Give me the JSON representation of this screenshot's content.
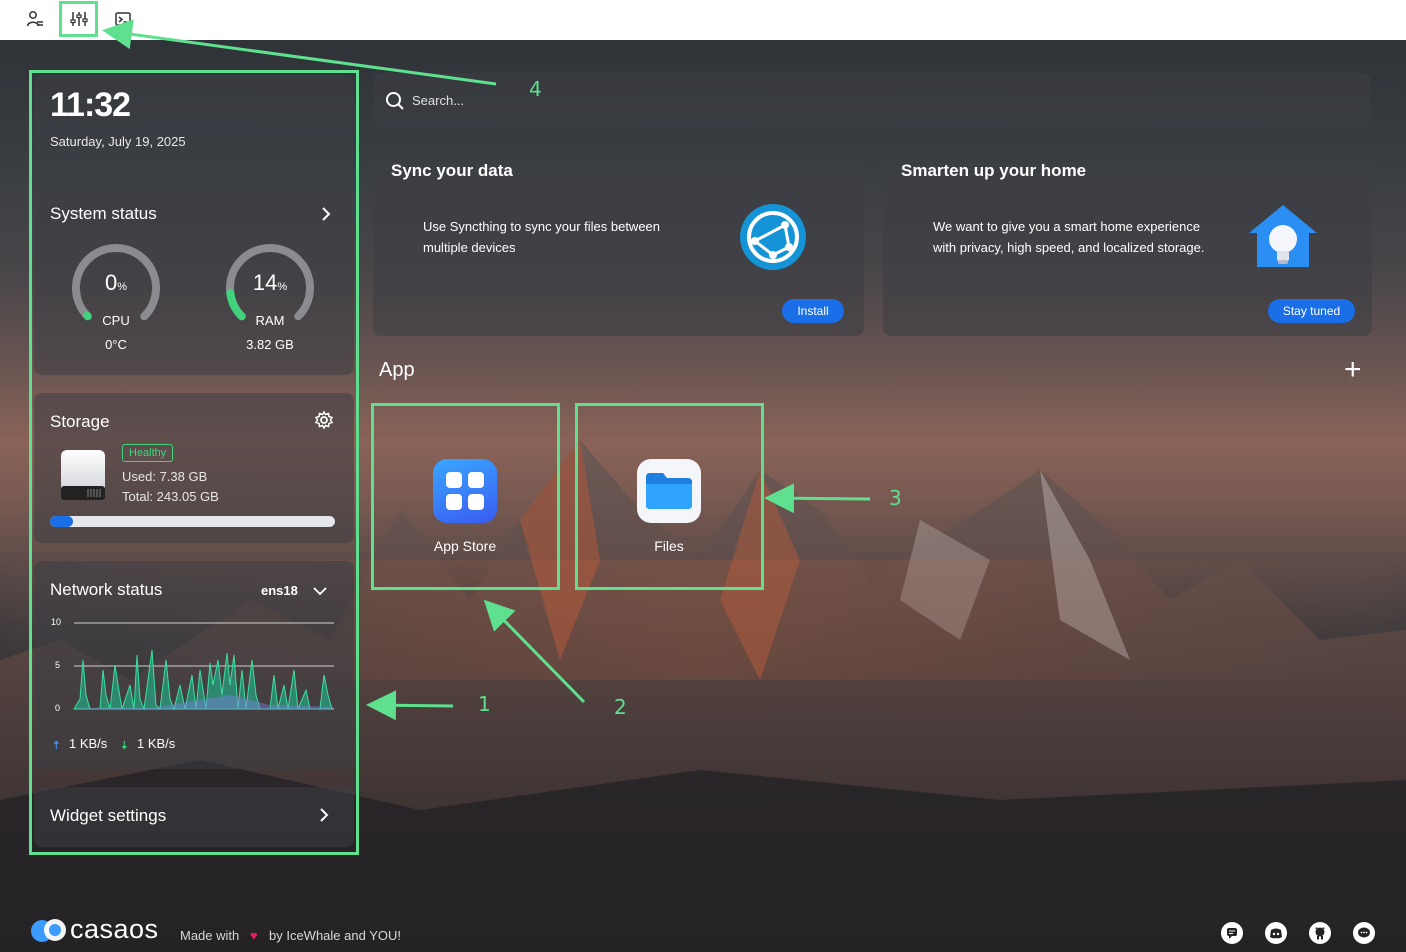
{
  "topbar": {
    "icons": [
      "user-settings-icon",
      "sliders-icon",
      "terminal-icon"
    ]
  },
  "search": {
    "placeholder": "Search..."
  },
  "clock": {
    "time": "11:32",
    "date": "Saturday, July 19, 2025"
  },
  "system_status": {
    "title": "System status",
    "cpu": {
      "value": "0",
      "unit": "%",
      "label": "CPU",
      "sub": "0°C",
      "percent": 0
    },
    "ram": {
      "value": "14",
      "unit": "%",
      "label": "RAM",
      "sub": "3.82 GB",
      "percent": 14
    }
  },
  "storage": {
    "title": "Storage",
    "badge": "Healthy",
    "used": "Used: 7.38 GB",
    "total": "Total: 243.05 GB",
    "used_fraction": 0.03
  },
  "network": {
    "title": "Network status",
    "interface": "ens18",
    "y_ticks": [
      "10",
      "5",
      "0"
    ],
    "upload": "1 KB/s",
    "download": "1 KB/s"
  },
  "widget_settings": {
    "label": "Widget settings"
  },
  "sync_card": {
    "title": "Sync your data",
    "text": "Use Syncthing to sync your files between multiple devices",
    "button": "Install"
  },
  "home_card": {
    "title": "Smarten up your home",
    "text": "We want to give you a smart home experience with privacy, high speed, and localized storage.",
    "button": "Stay tuned"
  },
  "apps": {
    "section_title": "App",
    "add_symbol": "+",
    "items": [
      {
        "label": "App Store",
        "icon": "app-store-icon"
      },
      {
        "label": "Files",
        "icon": "folder-icon"
      }
    ]
  },
  "footer": {
    "logo": "casaos",
    "made_with": "Made with",
    "by": "by IceWhale and YOU!",
    "icons": [
      "feedback-icon",
      "discord-icon",
      "github-icon",
      "chat-icon"
    ]
  },
  "annotations": [
    "1",
    "2",
    "3",
    "4"
  ],
  "colors": {
    "accent": "#1a6fe8",
    "annotation": "#5ee08f",
    "gauge_track": "#8a8c90",
    "gauge_fill": "#43d27c",
    "healthy": "#43d27c"
  }
}
